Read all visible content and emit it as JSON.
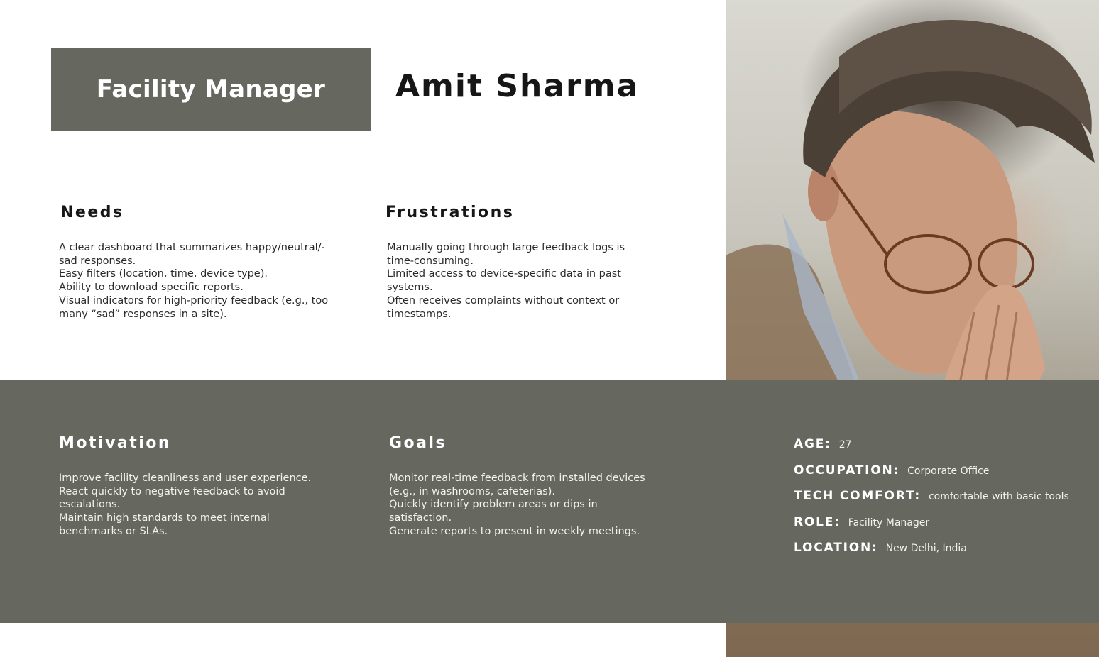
{
  "header": {
    "role_badge": "Facility Manager",
    "name": "Amit Sharma"
  },
  "needs": {
    "heading": "Needs",
    "items": [
      "A clear dashboard that summarizes happy/neutral/-sad responses.",
      "Easy filters (location, time, device type).",
      "Ability to download specific reports.",
      "Visual indicators for high-priority feedback (e.g., too many “sad” responses in a site)."
    ]
  },
  "frustrations": {
    "heading": "Frustrations",
    "items": [
      "Manually going through large feedback logs is time-consuming.",
      "Limited access to device-specific data in past systems.",
      "Often receives complaints without context or timestamps."
    ]
  },
  "motivation": {
    "heading": "Motivation",
    "items": [
      "Improve facility cleanliness and user experience.",
      "React quickly to negative feedback to avoid escalations.",
      "Maintain high standards to meet internal benchmarks or SLAs."
    ]
  },
  "goals": {
    "heading": "Goals",
    "items": [
      "Monitor real-time feedback from installed devices (e.g., in washrooms, cafeterias).",
      "Quickly identify problem areas or dips in satisfaction.",
      "Generate reports to present in weekly meetings."
    ]
  },
  "facts": [
    {
      "label": "AGE:",
      "value": "27"
    },
    {
      "label": "OCCUPATION:",
      "value": "Corporate Office"
    },
    {
      "label": "TECH COMFORT:",
      "value": "comfortable with basic tools"
    },
    {
      "label": "ROLE:",
      "value": "Facility Manager"
    },
    {
      "label": "LOCATION:",
      "value": "New Delhi, India"
    }
  ],
  "colors": {
    "band": "#66675f",
    "heading_dark": "#161616",
    "text_light": "#ffffff"
  },
  "photo": {
    "icon": "persona-photo"
  }
}
